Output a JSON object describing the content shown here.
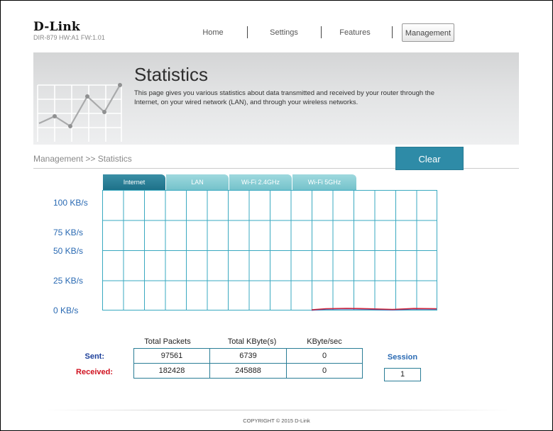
{
  "header": {
    "logo": "D-Link",
    "model_info": "DIR-879 HW:A1 FW:1.01",
    "nav": [
      {
        "label": "Home",
        "active": false
      },
      {
        "label": "Settings",
        "active": false
      },
      {
        "label": "Features",
        "active": false
      },
      {
        "label": "Management",
        "active": true
      }
    ]
  },
  "banner": {
    "title": "Statistics",
    "description": "This page gives you various statistics about data transmitted and received by your router through the Internet, on your wired network (LAN), and through your wireless networks.",
    "icon": "line-chart-icon"
  },
  "breadcrumb": "Management >> Statistics",
  "clear_button": "Clear",
  "tabs": [
    {
      "label": "Internet",
      "active": true
    },
    {
      "label": "LAN",
      "active": false
    },
    {
      "label": "Wi-Fi 2.4GHz",
      "active": false
    },
    {
      "label": "Wi-Fi 5GHz",
      "active": false
    }
  ],
  "graph": {
    "y_labels": [
      "100 KB/s",
      "75 KB/s",
      "50 KB/s",
      "25 KB/s",
      "0 KB/s"
    ],
    "sent_color": "#3a58b8",
    "received_color": "#d0263c"
  },
  "stats": {
    "headers": [
      "Total Packets",
      "Total KByte(s)",
      "KByte/sec"
    ],
    "sent": {
      "label": "Sent:",
      "packets": "97561",
      "kbytes": "6739",
      "rate": "0"
    },
    "received": {
      "label": "Received:",
      "packets": "182428",
      "kbytes": "245888",
      "rate": "0"
    },
    "session_label": "Session",
    "session_value": "1"
  },
  "footer": "COPYRIGHT © 2015 D-Link",
  "colors": {
    "accent": "#2e8ba7",
    "sent_label": "#1c3f9a",
    "received_label": "#d0101e",
    "axis_label": "#2a6ab3"
  }
}
